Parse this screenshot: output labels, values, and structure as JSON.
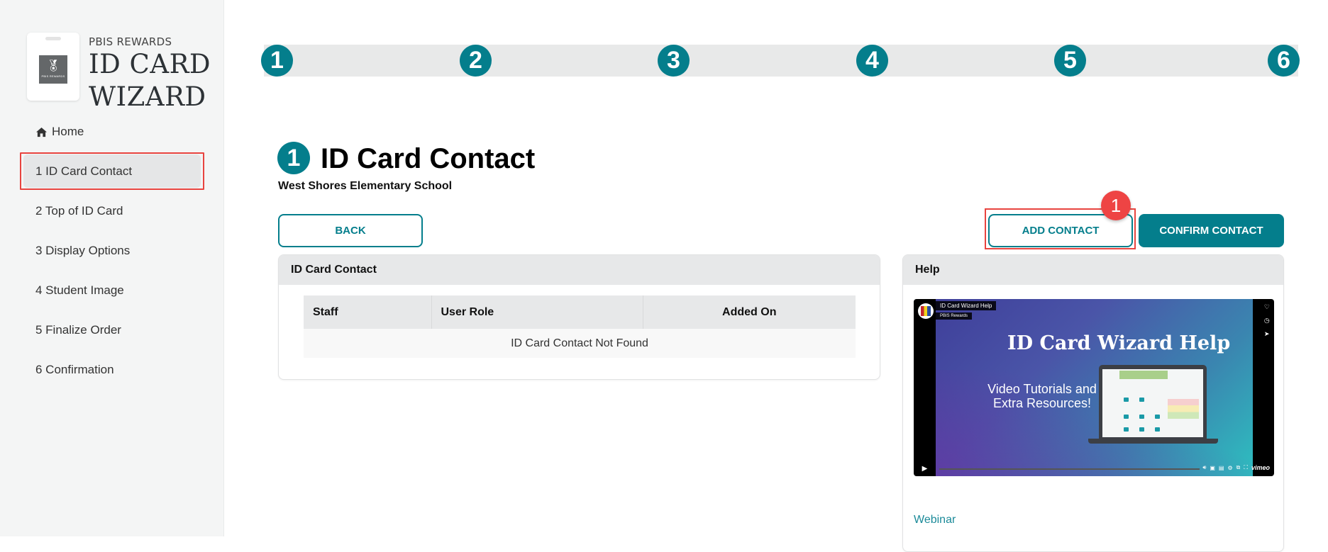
{
  "sidebar": {
    "logo": {
      "brand": "PBIS REWARDS",
      "title_line1": "ID CARD",
      "title_line2": "WIZARD",
      "badge_text": "PBIS REWARDS"
    },
    "home_label": "Home",
    "items": [
      {
        "label": "1 ID Card Contact",
        "active": true
      },
      {
        "label": "2 Top of ID Card",
        "active": false
      },
      {
        "label": "3 Display Options",
        "active": false
      },
      {
        "label": "4 Student Image",
        "active": false
      },
      {
        "label": "5 Finalize Order",
        "active": false
      },
      {
        "label": "6 Confirmation",
        "active": false
      }
    ]
  },
  "stepper": {
    "steps": [
      "1",
      "2",
      "3",
      "4",
      "5",
      "6"
    ],
    "current_step": 1
  },
  "header": {
    "step_number": "1",
    "title": "ID Card Contact",
    "subtitle": "West Shores Elementary School"
  },
  "actions": {
    "back_label": "BACK",
    "add_contact_label": "ADD CONTACT",
    "confirm_contact_label": "CONFIRM CONTACT",
    "annotation_badge": "1"
  },
  "contact_panel": {
    "title": "ID Card Contact",
    "columns": [
      "Staff",
      "User Role",
      "Added On"
    ],
    "empty_message": "ID Card Contact Not Found"
  },
  "help_panel": {
    "title": "Help",
    "video": {
      "title": "ID Card Wizard Help",
      "channel": "PBIS Rewards",
      "slide_title": "ID Card Wizard Help",
      "slide_subtitle": "Video Tutorials and Extra Resources!",
      "provider": "vimeo"
    },
    "webinar_link": "Webinar"
  },
  "colors": {
    "accent": "#047e8c",
    "highlight": "#e8443f",
    "badge": "#ee4444",
    "sidebar_bg": "#f4f5f5"
  }
}
